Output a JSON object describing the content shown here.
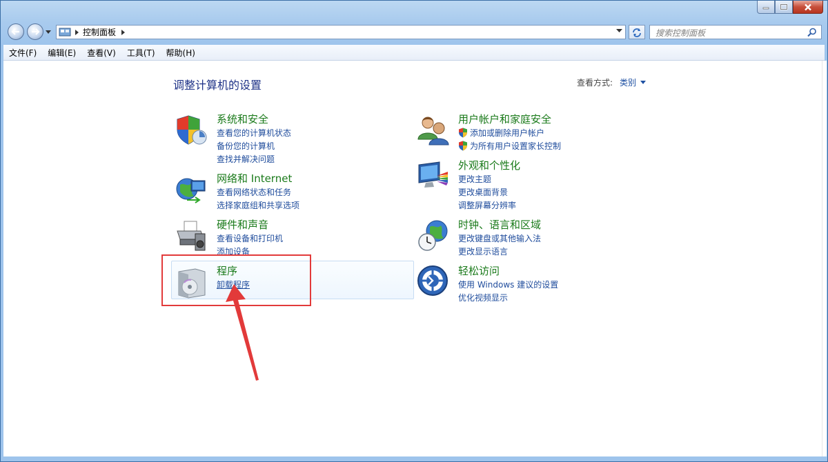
{
  "address": {
    "crumb": "控制面板"
  },
  "search": {
    "placeholder": "搜索控制面板"
  },
  "menu": [
    "文件(F)",
    "编辑(E)",
    "查看(V)",
    "工具(T)",
    "帮助(H)"
  ],
  "page": {
    "title": "调整计算机的设置",
    "view_by_label": "查看方式:",
    "view_by_value": "类别"
  },
  "categories": {
    "system": {
      "title": "系统和安全",
      "links": [
        "查看您的计算机状态",
        "备份您的计算机",
        "查找并解决问题"
      ]
    },
    "network": {
      "title": "网络和 Internet",
      "links": [
        "查看网络状态和任务",
        "选择家庭组和共享选项"
      ]
    },
    "hardware": {
      "title": "硬件和声音",
      "links": [
        "查看设备和打印机",
        "添加设备"
      ]
    },
    "programs": {
      "title": "程序",
      "links": [
        "卸载程序"
      ]
    },
    "users": {
      "title": "用户帐户和家庭安全",
      "links": [
        "添加或删除用户帐户",
        "为所有用户设置家长控制"
      ]
    },
    "appearance": {
      "title": "外观和个性化",
      "links": [
        "更改主题",
        "更改桌面背景",
        "调整屏幕分辨率"
      ]
    },
    "clock": {
      "title": "时钟、语言和区域",
      "links": [
        "更改键盘或其他输入法",
        "更改显示语言"
      ]
    },
    "ease": {
      "title": "轻松访问",
      "links": [
        "使用 Windows 建议的设置",
        "优化视频显示"
      ]
    }
  },
  "colors": {
    "title_green": "#1a7a1a",
    "link_blue": "#1f4c9c",
    "annotation_red": "#e23a3a"
  }
}
